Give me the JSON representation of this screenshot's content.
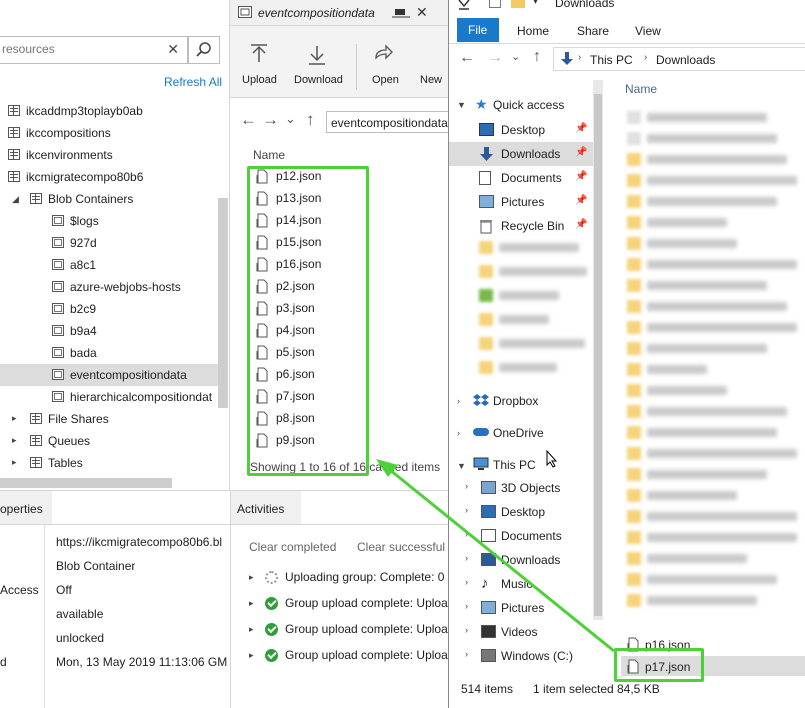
{
  "left_panel": {
    "search_placeholder": "resources",
    "refresh_label": "Refresh All",
    "tree": [
      {
        "label": "ikcaddmp3toplayb0ab",
        "kind": "table"
      },
      {
        "label": "ikccompositions",
        "kind": "table"
      },
      {
        "label": "ikcenvironments",
        "kind": "table"
      },
      {
        "label": "ikcmigratecompo80b6",
        "kind": "table",
        "expanded": true
      },
      {
        "label": "Blob Containers",
        "kind": "blob"
      },
      {
        "label": "$logs",
        "kind": "container"
      },
      {
        "label": "927d",
        "kind": "container"
      },
      {
        "label": "a8c1",
        "kind": "container"
      },
      {
        "label": "azure-webjobs-hosts",
        "kind": "container"
      },
      {
        "label": "b2c9",
        "kind": "container"
      },
      {
        "label": "b9a4",
        "kind": "container"
      },
      {
        "label": "bada",
        "kind": "container"
      },
      {
        "label": "eventcompositiondata",
        "kind": "container",
        "selected": true
      },
      {
        "label": "hierarchicalcompositiondat",
        "kind": "container"
      },
      {
        "label": "File Shares",
        "kind": "share"
      },
      {
        "label": "Queues",
        "kind": "queue"
      },
      {
        "label": "Tables",
        "kind": "tables"
      }
    ]
  },
  "properties": {
    "tab_label": "operties",
    "rows": [
      {
        "key": "",
        "value": "https://ikcmigratecompo80b6.bl"
      },
      {
        "key": "",
        "value": "Blob Container"
      },
      {
        "key": "Access",
        "value": "Off"
      },
      {
        "key": "",
        "value": "available"
      },
      {
        "key": "",
        "value": "unlocked"
      },
      {
        "key": "d",
        "value": "Mon, 13 May 2019 11:13:06 GM"
      }
    ]
  },
  "middle_panel": {
    "tab_title": "eventcompositiondata",
    "toolbar": [
      {
        "label": "Upload",
        "icon": "upload-icon"
      },
      {
        "label": "Download",
        "icon": "download-icon"
      },
      {
        "label": "Open",
        "icon": "open-icon"
      },
      {
        "label": "New",
        "icon": "new-icon"
      }
    ],
    "path_value": "eventcompositiondata",
    "column_name": "Name",
    "files": [
      "p12.json",
      "p13.json",
      "p14.json",
      "p15.json",
      "p16.json",
      "p2.json",
      "p3.json",
      "p4.json",
      "p5.json",
      "p6.json",
      "p7.json",
      "p8.json",
      "p9.json"
    ],
    "status": "Showing 1 to 16 of 16 cached items"
  },
  "activities": {
    "tab_label": "Activities",
    "clear_completed": "Clear completed",
    "clear_successful": "Clear successful",
    "items": [
      {
        "text": "Uploading group: Complete: 0",
        "status": "pending"
      },
      {
        "text": "Group upload complete: Uploa",
        "status": "done"
      },
      {
        "text": "Group upload complete: Uploa",
        "status": "done"
      },
      {
        "text": "Group upload complete: Uploa",
        "status": "done"
      }
    ]
  },
  "explorer": {
    "title": "Downloads",
    "ribbon_tabs": [
      "File",
      "Home",
      "Share",
      "View"
    ],
    "breadcrumb": [
      "This PC",
      "Downloads"
    ],
    "column_name": "Name",
    "quick_access_label": "Quick access",
    "quick_access": [
      "Desktop",
      "Downloads",
      "Documents",
      "Pictures",
      "Recycle Bin"
    ],
    "dropbox_label": "Dropbox",
    "onedrive_label": "OneDrive",
    "this_pc_label": "This PC",
    "this_pc_items": [
      "3D Objects",
      "Desktop",
      "Documents",
      "Downloads",
      "Music",
      "Pictures",
      "Videos",
      "Windows (C:)"
    ],
    "visible_files": [
      "p16.json",
      "p17.json"
    ],
    "status_items": "514 items",
    "status_selected": "1 item selected",
    "status_size": "84,5 KB"
  },
  "colors": {
    "accent_blue": "#1979ca",
    "selection_gray": "#dcdcdc",
    "highlight_green": "#4cd137",
    "success_green": "#2f9e3a"
  }
}
